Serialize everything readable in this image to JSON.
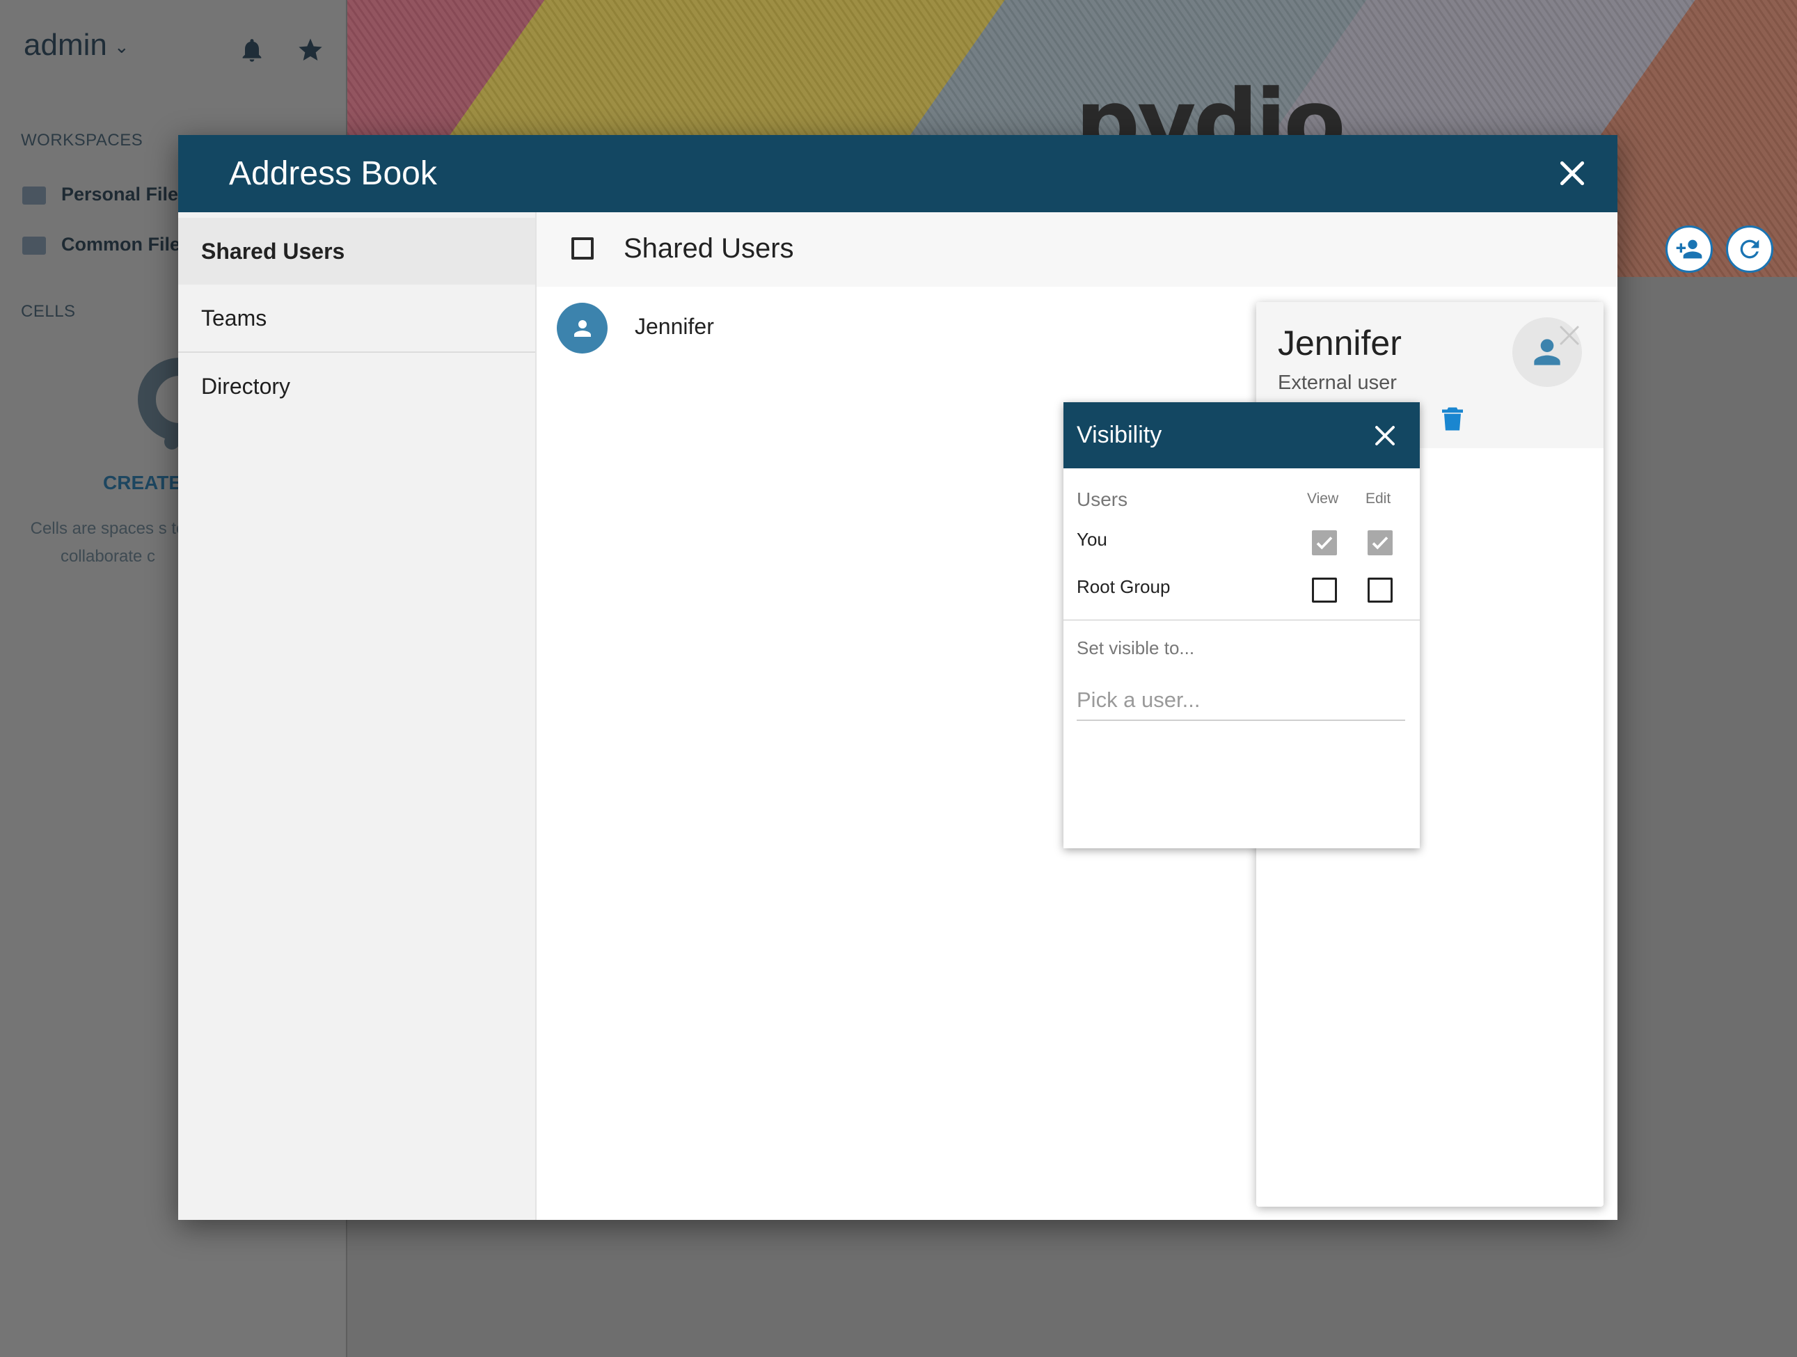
{
  "background": {
    "username": "admin",
    "workspaces_heading": "WORKSPACES",
    "workspaces": [
      "Personal Files",
      "Common Files"
    ],
    "cells_heading": "CELLS",
    "create_label": "CREATE",
    "cells_description": "Cells are spaces s to collaborate c",
    "logo_text": "pydio"
  },
  "modal": {
    "title": "Address Book",
    "nav": [
      {
        "label": "Shared Users",
        "active": true
      },
      {
        "label": "Teams",
        "active": false
      },
      {
        "label": "Directory",
        "active": false
      }
    ],
    "list_title": "Shared Users",
    "users": [
      {
        "name": "Jennifer"
      }
    ]
  },
  "detail_card": {
    "name": "Jennifer",
    "subtitle": "External user"
  },
  "visibility": {
    "title": "Visibility",
    "users_label": "Users",
    "col_view": "View",
    "col_edit": "Edit",
    "rows": [
      {
        "label": "You",
        "view": true,
        "edit": true
      },
      {
        "label": "Root Group",
        "view": false,
        "edit": false
      }
    ],
    "hint": "Set visible to...",
    "placeholder": "Pick a user..."
  },
  "colors": {
    "header": "#134762",
    "accent": "#1a74b3",
    "avatar": "#3c83ad"
  }
}
